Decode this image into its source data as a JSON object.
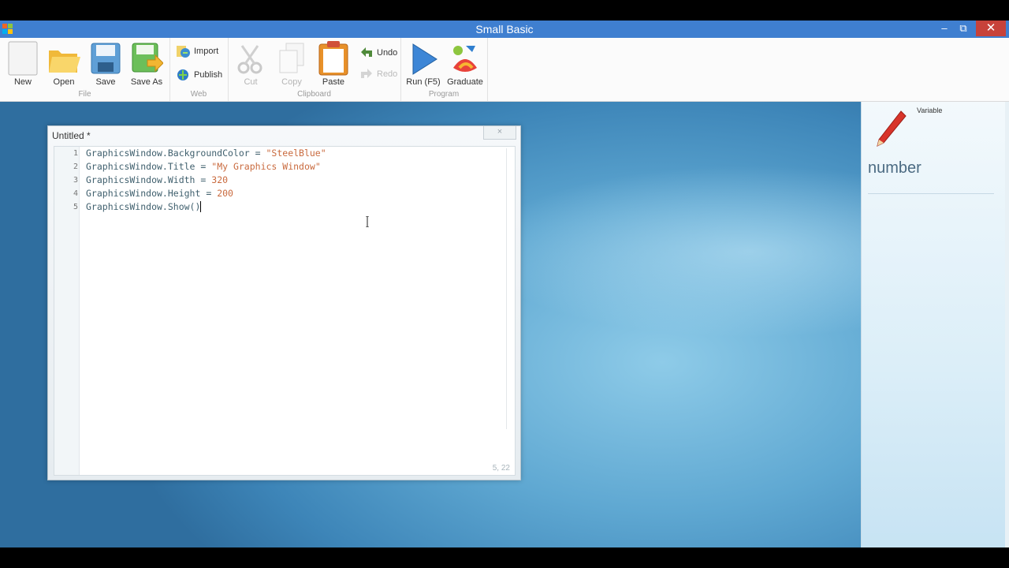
{
  "window": {
    "title": "Small Basic",
    "minimize": "–",
    "restore": "⧉",
    "close": "✕"
  },
  "ribbon": {
    "groups": {
      "file": "File",
      "web": "Web",
      "clipboard": "Clipboard",
      "program": "Program"
    },
    "buttons": {
      "new": "New",
      "open": "Open",
      "save": "Save",
      "save_as": "Save As",
      "import": "Import",
      "publish": "Publish",
      "cut": "Cut",
      "copy": "Copy",
      "paste": "Paste",
      "undo": "Undo",
      "redo": "Redo",
      "run": "Run (F5)",
      "graduate": "Graduate"
    }
  },
  "editor": {
    "title": "Untitled *",
    "close": "×",
    "cursor_position": "5, 22",
    "lines": [
      {
        "num": "1",
        "obj": "GraphicsWindow.BackgroundColor",
        "op": " = ",
        "val": "\"SteelBlue\"",
        "type": "string"
      },
      {
        "num": "2",
        "obj": "GraphicsWindow.Title",
        "op": " = ",
        "val": "\"My Graphics Window\"",
        "type": "string"
      },
      {
        "num": "3",
        "obj": "GraphicsWindow.Width",
        "op": " = ",
        "val": "320",
        "type": "number"
      },
      {
        "num": "4",
        "obj": "GraphicsWindow.Height",
        "op": " = ",
        "val": "200",
        "type": "number"
      },
      {
        "num": "5",
        "obj": "GraphicsWindow.Show()",
        "op": "",
        "val": "",
        "type": "call"
      }
    ]
  },
  "help_panel": {
    "label": "Variable",
    "name": "number",
    "icon": "pencil-icon"
  },
  "colors": {
    "titlebar": "#3f7fd0",
    "close_button": "#c7423a",
    "string_literal": "#c96a3e",
    "identifier": "#40606e"
  }
}
